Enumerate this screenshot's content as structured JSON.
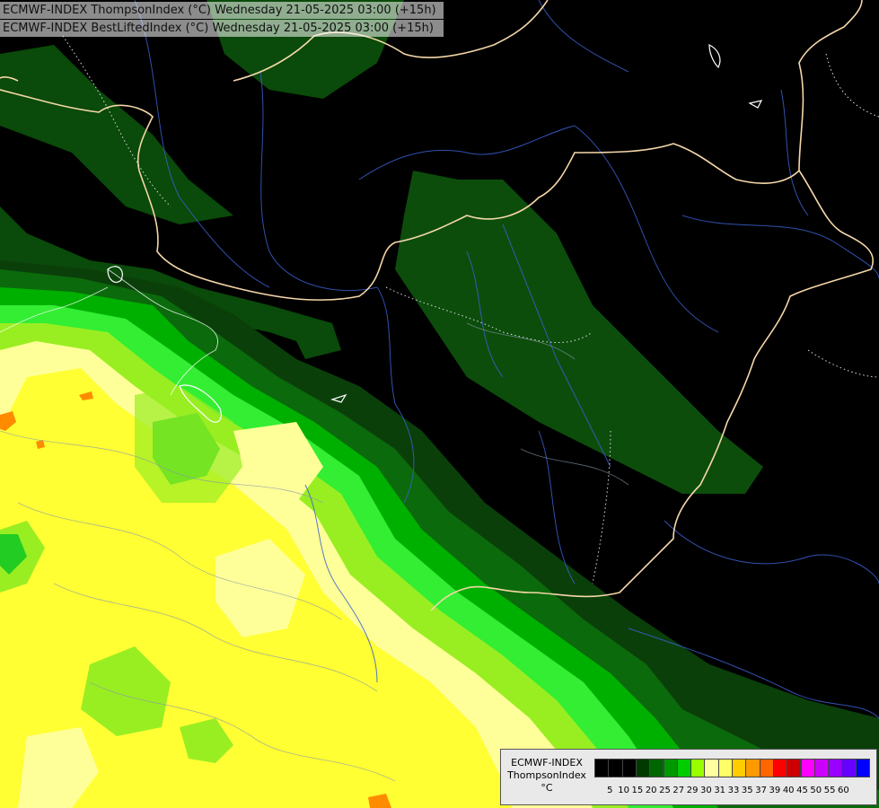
{
  "header": {
    "line1": "ECMWF-INDEX ThompsonIndex (°C) Wednesday 21-05-2025 03:00 (+15h)",
    "line2": "ECMWF-INDEX BestLiftedIndex (°C) Wednesday 21-05-2025 03:00 (+15h)"
  },
  "legend": {
    "title_line1": "ECMWF-INDEX",
    "title_line2": "ThompsonIndex",
    "unit": "°C",
    "ticks": [
      "5",
      "10",
      "15",
      "20",
      "25",
      "27",
      "29",
      "30",
      "31",
      "33",
      "35",
      "37",
      "39",
      "40",
      "45",
      "50",
      "55",
      "60"
    ],
    "colors": [
      "#000000",
      "#000000",
      "#000000",
      "#003a00",
      "#006600",
      "#009900",
      "#00cc00",
      "#99ff00",
      "#ffffa0",
      "#ffff66",
      "#ffcc00",
      "#ff9900",
      "#ff6600",
      "#ff0000",
      "#cc0000",
      "#ff00ff",
      "#cc00ff",
      "#9900ff",
      "#6600ff",
      "#0000ff"
    ]
  },
  "map": {
    "field_colors": {
      "dark_green": "#0a3a0a",
      "mid_green": "#0b5b0b",
      "green": "#00a000",
      "bright_green": "#22dd22",
      "lime": "#99ee11",
      "light_yellow": "#ffff99",
      "yellow": "#ffff33",
      "orange": "#ff8c00"
    }
  }
}
